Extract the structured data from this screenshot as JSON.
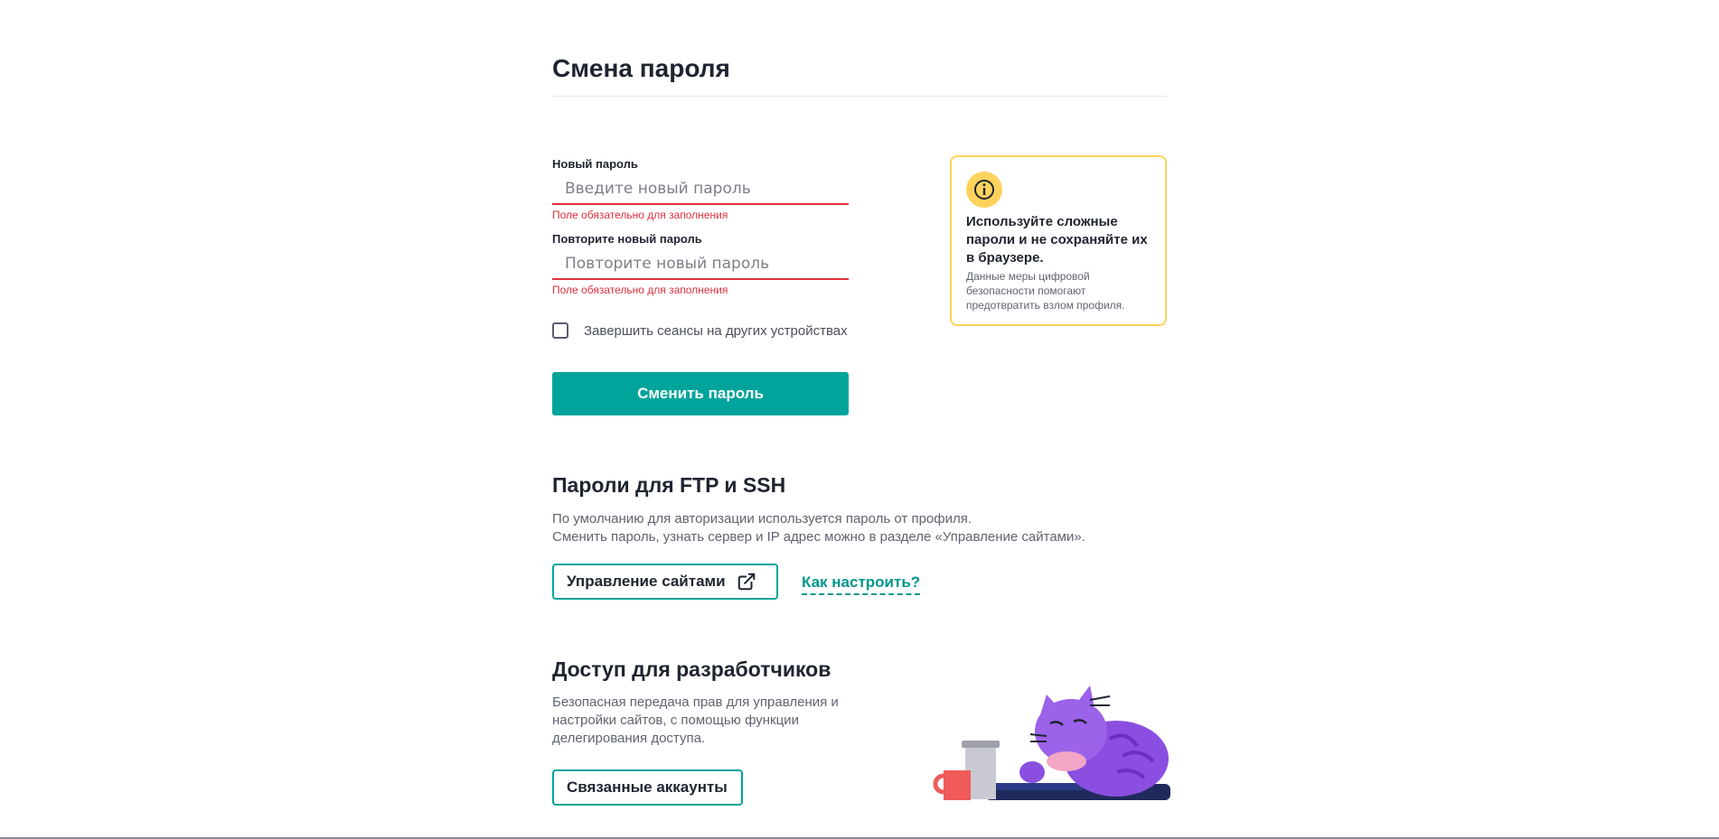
{
  "change_password": {
    "title": "Смена пароля",
    "new_password": {
      "label": "Новый пароль",
      "placeholder": "Введите новый пароль",
      "error": "Поле обязательно для заполнения"
    },
    "repeat_password": {
      "label": "Повторите новый пароль",
      "placeholder": "Повторите новый пароль",
      "error": "Поле обязательно для заполнения"
    },
    "end_sessions_label": "Завершить сеансы на других устройствах",
    "end_sessions_checked": false,
    "submit_label": "Сменить пароль"
  },
  "info_card": {
    "icon": "info-icon",
    "title": "Используйте сложные пароли и не сохраняйте их в браузере.",
    "text": "Данные меры цифровой безопасности помогают предотвратить взлом профиля."
  },
  "ftp_ssh": {
    "title": "Пароли для FTP и SSH",
    "line1": "По умолчанию для авторизации используется пароль от профиля.",
    "line2": "Сменить пароль, узнать сервер и IP адрес можно в разделе «Управление сайтами».",
    "manage_sites_label": "Управление сайтами",
    "manage_sites_icon": "external-link-icon",
    "how_to_label": "Как настроить?"
  },
  "dev_access": {
    "title": "Доступ для разработчиков",
    "text": "Безопасная передача прав для управления и настройки сайтов, с помощью функции делегирования доступа.",
    "linked_accounts_label": "Связанные аккаунты"
  },
  "colors": {
    "accent": "#00a49a",
    "error": "#e0313b",
    "info_border": "#ffd25c",
    "cat": "#8a4fe0"
  }
}
